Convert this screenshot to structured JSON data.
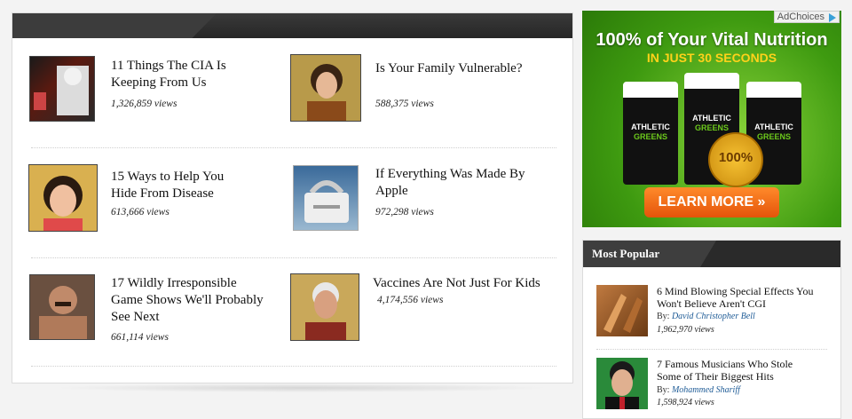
{
  "articles": [
    {
      "title_lines": [
        "11 Things The CIA Is",
        "Keeping From Us"
      ],
      "views": "1,326,859 views"
    },
    {
      "title_lines": [
        "Is Your Family Vulnerable?"
      ],
      "views": "588,375 views"
    },
    {
      "title_lines": [
        "15 Ways to Help You",
        "Hide From Disease"
      ],
      "views": "613,666 views"
    },
    {
      "title_lines": [
        "If Everything Was Made By",
        "Apple"
      ],
      "views": "972,298 views"
    },
    {
      "title_lines": [
        "17 Wildly Irresponsible",
        "Game Shows We'll Probably",
        "See Next"
      ],
      "views": "661,114 views"
    },
    {
      "title_lines": [
        "Vaccines Are Not Just For Kids"
      ],
      "views": "4,174,556 views"
    }
  ],
  "ad": {
    "adchoices": "AdChoices",
    "headline": "100% of Your Vital Nutrition",
    "subheadline": "IN JUST 30 SECONDS",
    "product_line1": "ATHLETIC",
    "product_line2": "GREENS",
    "seal_text": "100%",
    "button": "LEARN MORE"
  },
  "most_popular": {
    "title": "Most Popular",
    "by_label": "By:",
    "items": [
      {
        "title_lines": [
          "6 Mind Blowing Special Effects You",
          "Won't Believe Aren't CGI"
        ],
        "author": "David Christopher Bell",
        "views": "1,962,970 views"
      },
      {
        "title_lines": [
          "7 Famous Musicians Who Stole",
          "Some of Their Biggest Hits"
        ],
        "author": "Mohammed Shariff",
        "views": "1,598,924 views"
      }
    ]
  }
}
